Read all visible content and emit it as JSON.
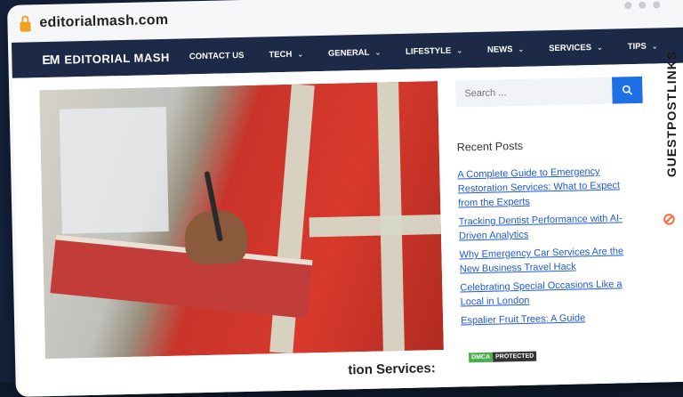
{
  "browser": {
    "url": "editorialmash.com"
  },
  "site": {
    "logo_mark": "EM",
    "logo_text": "EDITORIAL MASH",
    "nav": [
      {
        "label": "CONTACT US",
        "has_dropdown": false
      },
      {
        "label": "TECH",
        "has_dropdown": true
      },
      {
        "label": "GENERAL",
        "has_dropdown": true
      },
      {
        "label": "LIFESTYLE",
        "has_dropdown": true
      },
      {
        "label": "NEWS",
        "has_dropdown": true
      },
      {
        "label": "SERVICES",
        "has_dropdown": true
      },
      {
        "label": "TIPS",
        "has_dropdown": true
      }
    ]
  },
  "sidebar": {
    "search_placeholder": "Search ...",
    "recent_title": "Recent Posts",
    "posts": [
      "A Complete Guide to Emergency Restoration Services: What to Expect from the Experts",
      "Tracking Dentist Performance with AI-Driven Analytics",
      "Why Emergency Car Services Are the New Business Travel Hack",
      "Celebrating Special Occasions Like a Local in London",
      "Espalier Fruit Trees: A Guide"
    ],
    "dmca_left": "DMCA",
    "dmca_right": "PROTECTED"
  },
  "article": {
    "title_fragment": "tion Services:"
  },
  "overlay": {
    "brand": "GUESTPOSTLINKS"
  },
  "colors": {
    "nav_bg": "#1c2a48",
    "accent": "#1e6ee6",
    "link": "#1e5bd6",
    "brand_orange": "#ff6a3d"
  }
}
